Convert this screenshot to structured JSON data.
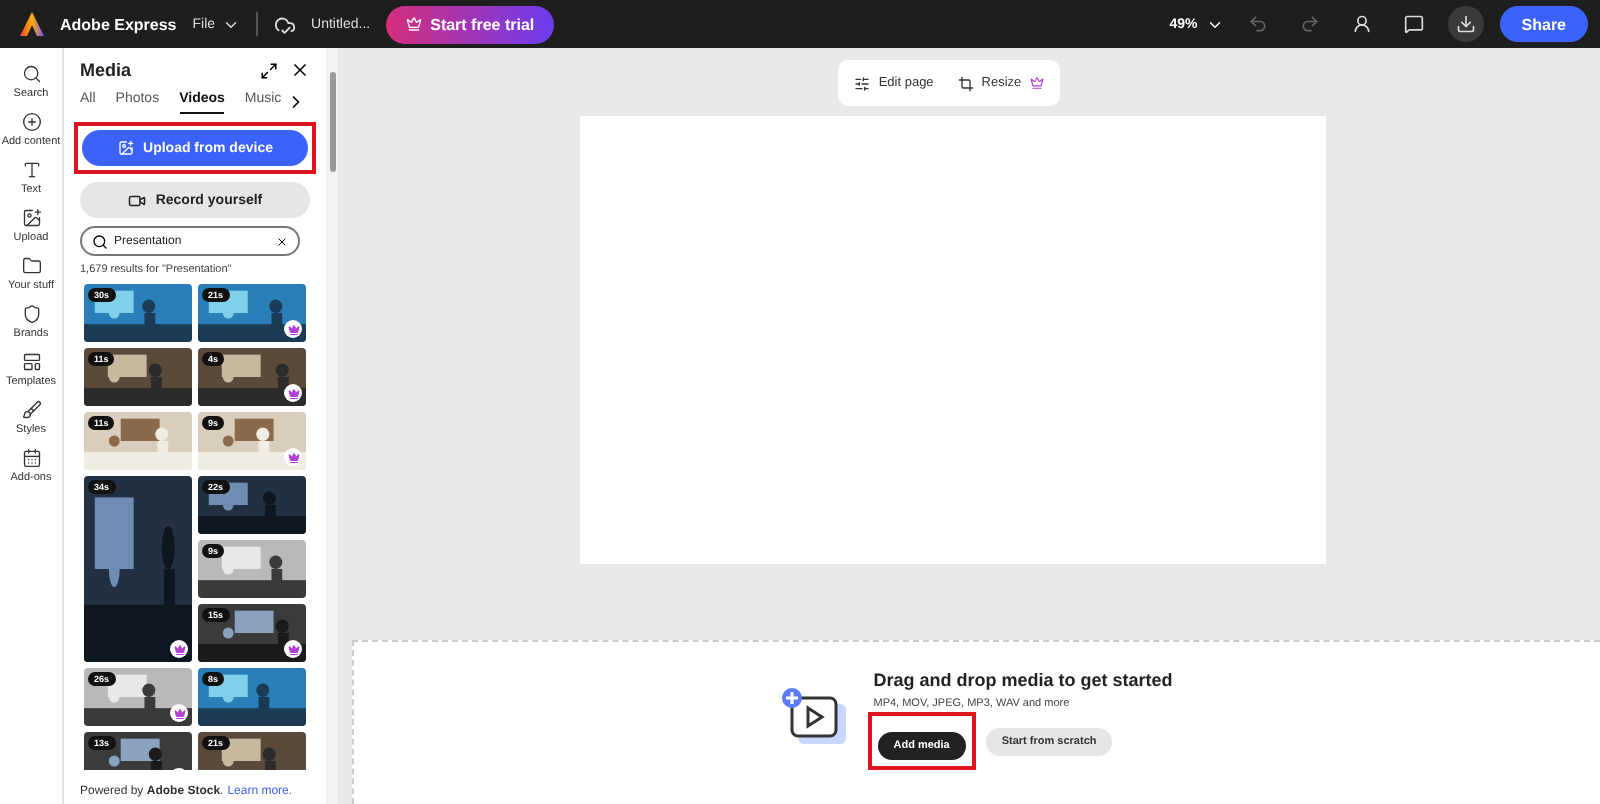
{
  "topbar": {
    "app_name": "Adobe Express",
    "file_menu": "File",
    "document_title": "Untitled...",
    "trial_button": "Start free trial",
    "zoom": "49%",
    "share_button": "Share"
  },
  "rail": [
    {
      "kind": "search",
      "label": "Search"
    },
    {
      "kind": "add",
      "label": "Add content"
    },
    {
      "kind": "text",
      "label": "Text"
    },
    {
      "kind": "upload",
      "label": "Upload"
    },
    {
      "kind": "folder",
      "label": "Your stuff"
    },
    {
      "kind": "brand",
      "label": "Brands"
    },
    {
      "kind": "templates",
      "label": "Templates"
    },
    {
      "kind": "styles",
      "label": "Styles"
    },
    {
      "kind": "addons",
      "label": "Add-ons"
    }
  ],
  "panel": {
    "title": "Media",
    "tabs": [
      {
        "label": "All",
        "selected": false
      },
      {
        "label": "Photos",
        "selected": false
      },
      {
        "label": "Videos",
        "selected": true
      },
      {
        "label": "Music",
        "selected": false
      }
    ],
    "upload_button": "Upload from device",
    "record_button": "Record yourself",
    "search": {
      "value": "Presentation"
    },
    "results": "1,679 results for \"Presentation\"",
    "columns": [
      [
        {
          "duration": "30s",
          "premium": false,
          "kind": "short"
        },
        {
          "duration": "11s",
          "premium": false,
          "kind": "short"
        },
        {
          "duration": "11s",
          "premium": false,
          "kind": "short"
        },
        {
          "duration": "34s",
          "premium": true,
          "kind": "tall"
        },
        {
          "duration": "26s",
          "premium": true,
          "kind": "short"
        },
        {
          "duration": "13s",
          "premium": true,
          "kind": "short"
        }
      ],
      [
        {
          "duration": "21s",
          "premium": true,
          "kind": "short"
        },
        {
          "duration": "4s",
          "premium": true,
          "kind": "short"
        },
        {
          "duration": "9s",
          "premium": true,
          "kind": "short"
        },
        {
          "duration": "22s",
          "premium": false,
          "kind": "short"
        },
        {
          "duration": "9s",
          "premium": false,
          "kind": "short"
        },
        {
          "duration": "15s",
          "premium": true,
          "kind": "short"
        },
        {
          "duration": "8s",
          "premium": false,
          "kind": "short"
        },
        {
          "duration": "21s",
          "premium": false,
          "kind": "short"
        }
      ]
    ],
    "footer": "Powered by **Adobe Stock**.",
    "footer_link": "Learn more."
  },
  "canvas_toolbar": {
    "edit_page": "Edit page",
    "resize": "Resize"
  },
  "drop_zone": {
    "title": "Drag and drop media to get started",
    "formats": "MP4, MOV, JPEG, MP3, WAV and more",
    "primary_button": "Add media",
    "secondary_button": "Start from scratch"
  }
}
